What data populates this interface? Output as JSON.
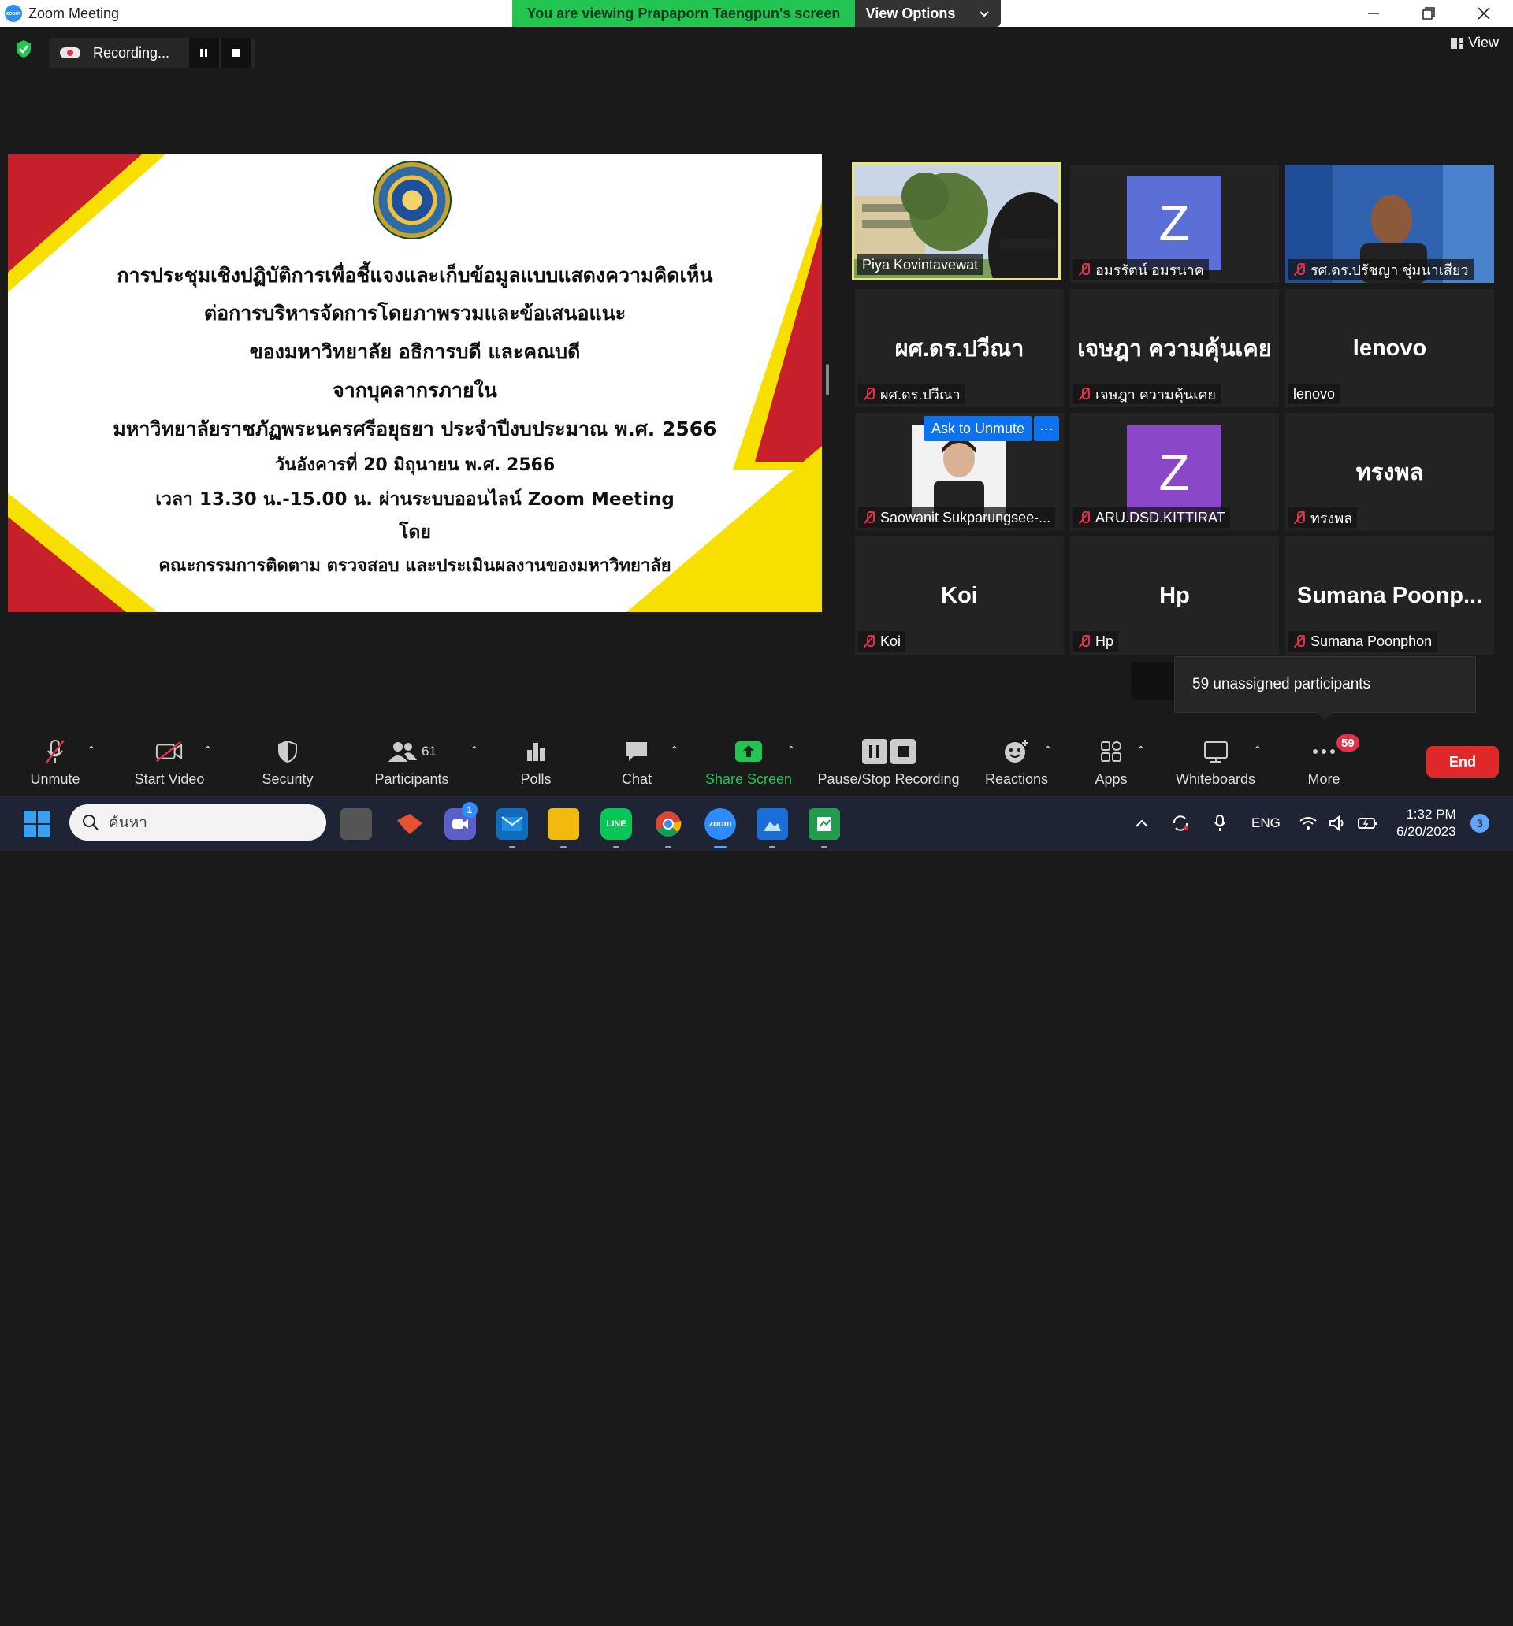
{
  "titlebar": {
    "app_title": "Zoom Meeting",
    "logo_text": "zoom",
    "viewing_banner": "You are viewing Prapaporn Taengpun's screen",
    "view_options": "View Options",
    "minimize": "—",
    "restore": "❐",
    "close": "✕"
  },
  "meeting": {
    "recording_label": "Recording...",
    "pause_icon": "▮▮",
    "stop_icon": "■",
    "view_label": "View"
  },
  "slide": {
    "lines": [
      "การประชุมเชิงปฏิบัติการเพื่อชี้แจงและเก็บข้อมูลแบบแสดงความคิดเห็น",
      "ต่อการบริหารจัดการโดยภาพรวมและข้อเสนอแนะ",
      "ของมหาวิทยาลัย อธิการบดี และคณบดี",
      "จากบุคลากรภายใน",
      "มหาวิทยาลัยราชภัฏพระนครศรีอยุธยา ประจำปีงบประมาณ พ.ศ. 2566",
      "วันอังคารที่ 20 มิถุนายน พ.ศ. 2566",
      "เวลา 13.30 น.-15.00 น. ผ่านระบบออนไลน์ Zoom Meeting",
      "โดย",
      "คณะกรรมการติดตาม ตรวจสอบ และประเมินผลงานของมหาวิทยาลัย"
    ],
    "colors": {
      "red": "#c8202a",
      "yellow": "#f7e000"
    }
  },
  "gallery": {
    "tiles": [
      {
        "big": "",
        "label": "Piya Kovintavewat",
        "muted": false
      },
      {
        "big": "Z",
        "label": "อมรรัตน์ อมรนาค",
        "muted": true,
        "avatar_color": "#5b6fd6"
      },
      {
        "big": "",
        "label": "รศ.ดร.ปรัชญา ชุ่มนาเสียว",
        "muted": true
      },
      {
        "big": "ผศ.ดร.ปวีณา",
        "label": "ผศ.ดร.ปวีณา",
        "muted": true
      },
      {
        "big": "เจษฎา ความคุ้นเคย",
        "label": "เจษฎา ความคุ้นเคย",
        "muted": true
      },
      {
        "big": "lenovo",
        "label": "lenovo",
        "muted": false
      },
      {
        "big": "",
        "label": "Saowanit Sukparungsee-...",
        "muted": true
      },
      {
        "big": "Z",
        "label": "ARU.DSD.KITTIRAT",
        "muted": true,
        "avatar_color": "#8a48c9"
      },
      {
        "big": "ทรงพล",
        "label": "ทรงพล",
        "muted": true
      },
      {
        "big": "Koi",
        "label": "Koi",
        "muted": true
      },
      {
        "big": "Hp",
        "label": "Hp",
        "muted": true
      },
      {
        "big": "Sumana  Poonp...",
        "label": "Sumana Poonphon",
        "muted": true
      }
    ],
    "ask_to_unmute": "Ask to Unmute",
    "ask_more": "···",
    "active_speaker_color": "#e8e870"
  },
  "tooltip": {
    "text": "59 unassigned participants"
  },
  "toolbar": {
    "unmute": "Unmute",
    "start_video": "Start Video",
    "security": "Security",
    "participants": "Participants",
    "participants_count": "61",
    "polls": "Polls",
    "chat": "Chat",
    "share_screen": "Share Screen",
    "pause_stop_recording": "Pause/Stop Recording",
    "reactions": "Reactions",
    "apps": "Apps",
    "whiteboards": "Whiteboards",
    "more": "More",
    "more_badge": "59",
    "end": "End",
    "share_color": "#23c552"
  },
  "taskbar": {
    "search_placeholder": "ค้นหา",
    "teams_badge": "1",
    "zoom_label": "zoom",
    "lang": "ENG",
    "time": "1:32 PM",
    "date": "6/20/2023",
    "notif_count": "3"
  }
}
